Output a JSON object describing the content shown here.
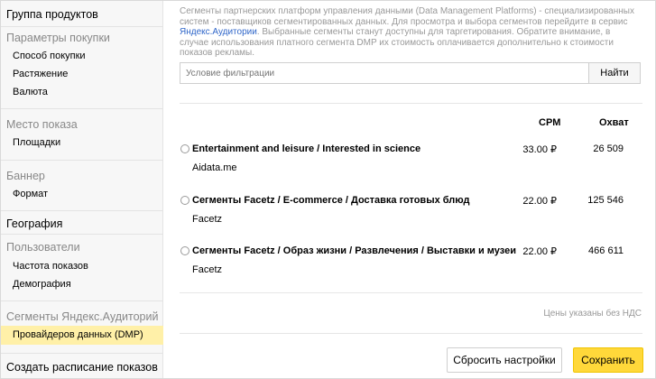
{
  "sidebar": {
    "product_group": "Группа продуктов",
    "purchase_params": "Параметры покупки",
    "purchase_items": [
      "Способ покупки",
      "Растяжение",
      "Валюта"
    ],
    "placement": "Место показа",
    "placement_items": [
      "Площадки"
    ],
    "banner": "Баннер",
    "banner_items": [
      "Формат"
    ],
    "geography": "География",
    "users": "Пользователи",
    "users_items": [
      "Частота показов",
      "Демография"
    ],
    "audience_segments": "Сегменты Яндекс.Аудиторий",
    "audience_items": [
      "Провайдеров данных (DMP)"
    ],
    "schedule": "Создать расписание показов",
    "active_color": "#fff0a8"
  },
  "main": {
    "desc_part1": "Сегменты партнерских платформ управления данными (Data Management Platforms) - специализированных систем - поставщиков сегментированных данных. Для просмотра и выбора сегментов перейдите в сервис ",
    "desc_link": "Яндекс.Аудитории",
    "desc_part2": ". Выбранные сегменты станут доступны для таргетирования. Обратите внимание, в случае использования платного сегмента DMP их стоимость оплачивается дополнительно к стоимости показов рекламы.",
    "filter_placeholder": "Условие фильтрации",
    "find_label": "Найти",
    "col_cpm": "CPM",
    "col_reach": "Охват",
    "rows": [
      {
        "title": "Entertainment and leisure / Interested in science",
        "provider": "Aidata.me",
        "cpm": "33.00 ₽",
        "reach": "26 509"
      },
      {
        "title": "Сегменты Facetz / E-commerce / Доставка готовых блюд",
        "provider": "Facetz",
        "cpm": "22.00 ₽",
        "reach": "125 546"
      },
      {
        "title": "Сегменты Facetz / Образ жизни / Развлечения / Выставки и музеи",
        "provider": "Facetz",
        "cpm": "22.00 ₽",
        "reach": "466 611"
      }
    ],
    "note": "Цены указаны без НДС",
    "reset_label": "Сбросить настройки",
    "save_label": "Сохранить",
    "save_color": "#ffd83a",
    "link_color": "#2f66c9"
  }
}
